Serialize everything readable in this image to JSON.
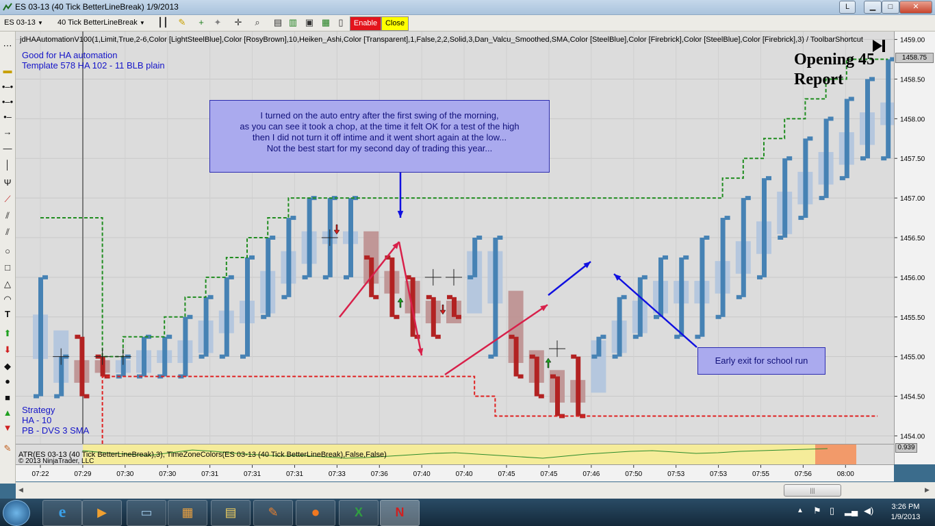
{
  "window": {
    "title": "ES 03-13 (40 Tick BetterLineBreak)  1/9/2013",
    "mini_label": "L"
  },
  "toolbar": {
    "instrument": "ES 03-13",
    "interval": "40 Tick BetterLineBreak",
    "enable_label": "Enable",
    "close_label": "Close",
    "enable_color": "#e3141c",
    "close_color": "#ffff00"
  },
  "chart": {
    "indicator_label": "jdHAAutomationV100(1,Limit,True,2-6,Color [LightSteelBlue],Color [RosyBrown],10,Heiken_Ashi,Color [Transparent],1,False,2,2,Solid,3,Dan_Valcu_Smoothed,SMA,Color [SteelBlue],Color [Firebrick],Color [SteelBlue],Color [Firebrick],3) / ToolbarShortcut",
    "template_lines": [
      "Good for HA automation",
      "Template 578 HA 102 - 11 BLB plain"
    ],
    "strategy_lines": [
      "Strategy",
      "HA - 10",
      "PB - DVS 3 SMA"
    ],
    "opening_report": [
      "Opening 45",
      "Report"
    ],
    "note_main": [
      "I turned on the auto entry after the first swing of the morning,",
      "as you can see it took a chop, at the time it felt OK for a test of the high",
      "then I did not turn it off intime and it went short again at the low...",
      "Not the best start for my second day of trading this year..."
    ],
    "note_exit": "Early exit for school run",
    "atr_label": "ATR(ES 03-13 (40 Tick BetterLineBreak),3), TimeZoneColors(ES 03-13 (40 Tick BetterLineBreak),False,False)",
    "copyright": "© 2013 NinjaTrader, LLC",
    "current_price": "1458.75",
    "atr_value": "0.939",
    "colors": {
      "up": "#4682b4",
      "down": "#b22222",
      "ha_up": "#b0c4de",
      "ha_down": "#bc8f8f",
      "stop_green": "#1e8c1e",
      "stop_red": "#e02020"
    }
  },
  "chart_data": {
    "type": "bar",
    "y_ticks": [
      "1459.00",
      "1458.50",
      "1458.00",
      "1457.50",
      "1457.00",
      "1456.50",
      "1456.00",
      "1455.50",
      "1455.00",
      "1454.50",
      "1454.00"
    ],
    "x_ticks": [
      "07:22",
      "07:29",
      "07:30",
      "07:30",
      "07:31",
      "07:31",
      "07:31",
      "07:33",
      "07:36",
      "07:40",
      "07:40",
      "07:45",
      "07:45",
      "07:46",
      "07:50",
      "07:53",
      "07:53",
      "07:55",
      "07:56",
      "08:00"
    ],
    "ylim": [
      1453.9,
      1459.1
    ],
    "line_break_bars": [
      {
        "dir": "up",
        "open": 1454.5,
        "close": 1456.0
      },
      {
        "dir": "up",
        "open": 1454.5,
        "close": 1455.0
      },
      {
        "dir": "down",
        "open": 1455.25,
        "close": 1454.5
      },
      {
        "dir": "down",
        "open": 1455.0,
        "close": 1454.75
      },
      {
        "dir": "up",
        "open": 1454.75,
        "close": 1455.0
      },
      {
        "dir": "up",
        "open": 1454.75,
        "close": 1455.25
      },
      {
        "dir": "up",
        "open": 1454.75,
        "close": 1455.25
      },
      {
        "dir": "up",
        "open": 1454.75,
        "close": 1455.5
      },
      {
        "dir": "up",
        "open": 1455.0,
        "close": 1455.75
      },
      {
        "dir": "up",
        "open": 1455.0,
        "close": 1456.0
      },
      {
        "dir": "up",
        "open": 1455.0,
        "close": 1456.25
      },
      {
        "dir": "up",
        "open": 1455.5,
        "close": 1456.5
      },
      {
        "dir": "up",
        "open": 1455.75,
        "close": 1456.75
      },
      {
        "dir": "up",
        "open": 1456.0,
        "close": 1457.0
      },
      {
        "dir": "up",
        "open": 1456.0,
        "close": 1457.0
      },
      {
        "dir": "up",
        "open": 1456.0,
        "close": 1457.0
      },
      {
        "dir": "down",
        "open": 1456.25,
        "close": 1455.75
      },
      {
        "dir": "down",
        "open": 1456.25,
        "close": 1455.5
      },
      {
        "dir": "down",
        "open": 1456.0,
        "close": 1455.25
      },
      {
        "dir": "down",
        "open": 1455.75,
        "close": 1455.25
      },
      {
        "dir": "down",
        "open": 1455.75,
        "close": 1455.5
      },
      {
        "dir": "up",
        "open": 1456.0,
        "close": 1456.5
      },
      {
        "dir": "up",
        "open": 1455.0,
        "close": 1456.5
      },
      {
        "dir": "down",
        "open": 1455.25,
        "close": 1454.75
      },
      {
        "dir": "down",
        "open": 1455.0,
        "close": 1454.5
      },
      {
        "dir": "down",
        "open": 1454.75,
        "close": 1454.25
      },
      {
        "dir": "down",
        "open": 1455.0,
        "close": 1454.25
      },
      {
        "dir": "up",
        "open": 1455.0,
        "close": 1455.25
      },
      {
        "dir": "up",
        "open": 1455.0,
        "close": 1455.75
      },
      {
        "dir": "up",
        "open": 1455.25,
        "close": 1456.0
      },
      {
        "dir": "up",
        "open": 1455.5,
        "close": 1456.25
      },
      {
        "dir": "up",
        "open": 1455.25,
        "close": 1456.25
      },
      {
        "dir": "up",
        "open": 1455.25,
        "close": 1456.5
      },
      {
        "dir": "up",
        "open": 1455.5,
        "close": 1456.75
      },
      {
        "dir": "up",
        "open": 1455.75,
        "close": 1457.0
      },
      {
        "dir": "up",
        "open": 1456.0,
        "close": 1457.25
      },
      {
        "dir": "up",
        "open": 1456.5,
        "close": 1457.5
      },
      {
        "dir": "up",
        "open": 1456.75,
        "close": 1457.75
      },
      {
        "dir": "up",
        "open": 1457.0,
        "close": 1458.0
      },
      {
        "dir": "up",
        "open": 1457.25,
        "close": 1458.25
      },
      {
        "dir": "up",
        "open": 1457.5,
        "close": 1458.5
      },
      {
        "dir": "up",
        "open": 1457.5,
        "close": 1458.75
      }
    ],
    "grid": true
  }
}
